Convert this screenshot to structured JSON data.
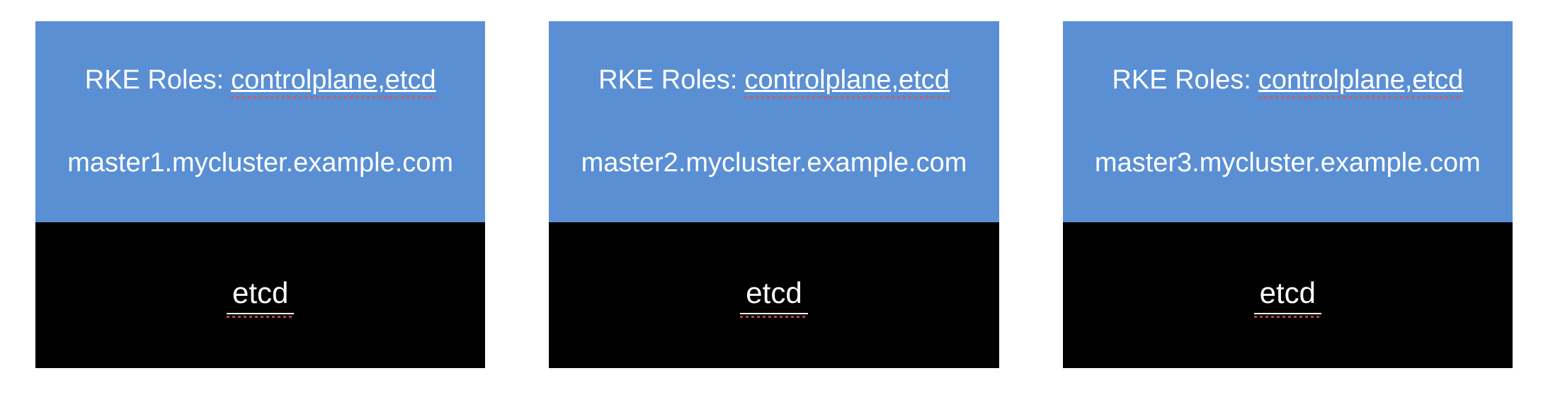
{
  "nodes": [
    {
      "roles_label": "RKE Roles:",
      "roles_value": "controlplane,etcd",
      "hostname": "master1.mycluster.example.com",
      "component": "etcd"
    },
    {
      "roles_label": "RKE Roles:",
      "roles_value": "controlplane,etcd",
      "hostname": "master2.mycluster.example.com",
      "component": "etcd"
    },
    {
      "roles_label": "RKE Roles:",
      "roles_value": "controlplane,etcd",
      "hostname": "master3.mycluster.example.com",
      "component": "etcd"
    }
  ],
  "colors": {
    "node_top_bg": "#5a8fd4",
    "node_bottom_bg": "#000000",
    "text": "#ffffff"
  }
}
